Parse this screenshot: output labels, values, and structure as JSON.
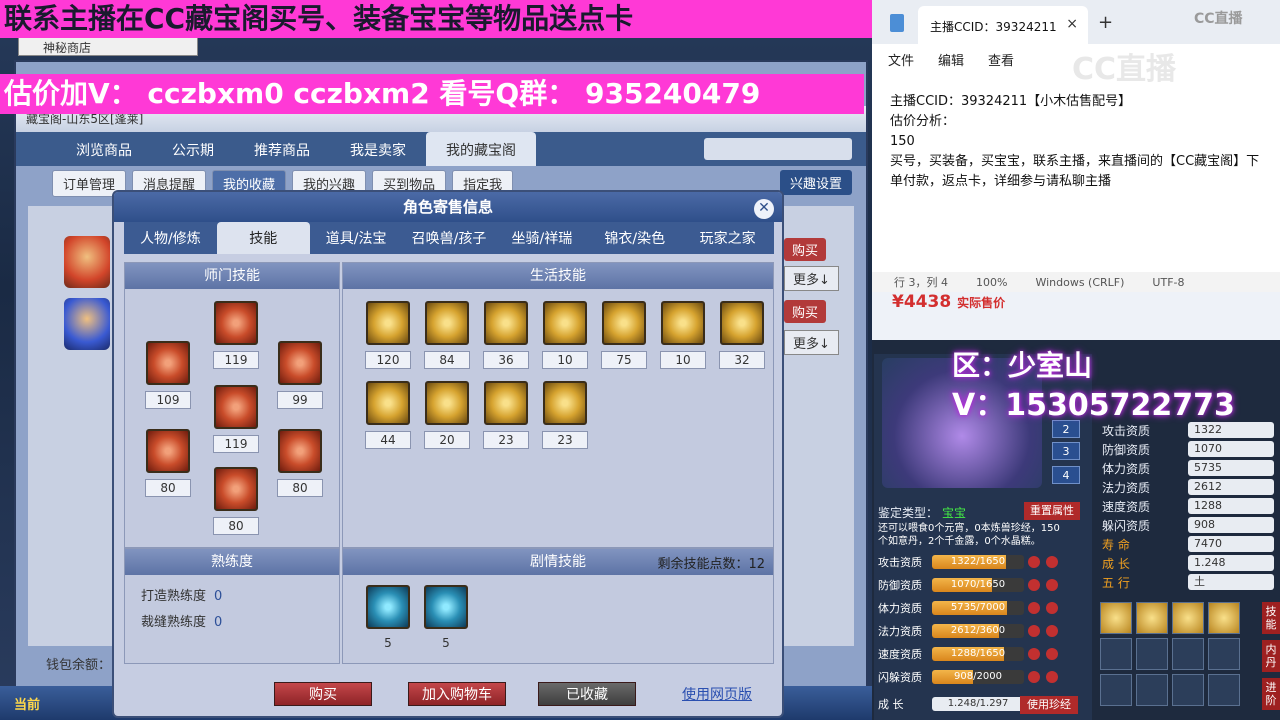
{
  "banners": {
    "top": "联系主播在CC藏宝阁买号、装备宝宝等物品送点卡",
    "middle": "估价加V： cczbxm0   cczbxm2   看号Q群： 935240479"
  },
  "game": {
    "small_tab": "神秘商店",
    "title_text": "藏宝阁-山东5区[蓬莱]",
    "tabs": [
      {
        "label": "浏览商品"
      },
      {
        "label": "公示期"
      },
      {
        "label": "推荐商品"
      },
      {
        "label": "我是卖家"
      },
      {
        "label": "我的藏宝阁"
      }
    ],
    "sub_tabs": [
      {
        "label": "订单管理"
      },
      {
        "label": "消息提醒"
      },
      {
        "label": "我的收藏"
      },
      {
        "label": "我的兴趣"
      },
      {
        "label": "买到物品"
      },
      {
        "label": "指定我"
      }
    ],
    "interest_setting": "兴趣设置",
    "buy_label": "购买",
    "more_label": "更多↓",
    "wallet_label": "钱包余额：",
    "taskbar_label": "当前"
  },
  "modal": {
    "title": "角色寄售信息",
    "close": "✕",
    "tabs": [
      {
        "label": "人物/修炼"
      },
      {
        "label": "技能"
      },
      {
        "label": "道具/法宝"
      },
      {
        "label": "召唤兽/孩子"
      },
      {
        "label": "坐骑/祥瑞"
      },
      {
        "label": "锦衣/染色"
      },
      {
        "label": "玩家之家"
      }
    ],
    "sect_title": "师门技能",
    "sect_skills": [
      {
        "level": "119",
        "icon": "red-skill-icon"
      },
      {
        "level": "109",
        "icon": "red-skill-icon"
      },
      {
        "level": "99",
        "icon": "red-skill-icon"
      },
      {
        "level": "119",
        "icon": "red-skill-icon"
      },
      {
        "level": "80",
        "icon": "red-skill-icon"
      },
      {
        "level": "80",
        "icon": "red-skill-icon"
      },
      {
        "level": "80",
        "icon": "red-skill-icon"
      }
    ],
    "life_title": "生活技能",
    "life_skills": [
      {
        "level": "120"
      },
      {
        "level": "84"
      },
      {
        "level": "36"
      },
      {
        "level": "10"
      },
      {
        "level": "75"
      },
      {
        "level": "10"
      },
      {
        "level": "32"
      },
      {
        "level": "44"
      },
      {
        "level": "20"
      },
      {
        "level": "23"
      },
      {
        "level": "23"
      }
    ],
    "prof_title": "熟练度",
    "forging_label": "打造熟练度",
    "forging_value": "0",
    "tailoring_label": "裁缝熟练度",
    "tailoring_value": "0",
    "story_title": "剧情技能",
    "remaining_label": "剩余技能点数：",
    "remaining_value": "12",
    "story_skills": [
      {
        "level": "5"
      },
      {
        "level": "5"
      }
    ],
    "buttons": {
      "buy": "购买",
      "add_cart": "加入购物车",
      "favorited": "已收藏",
      "web": "使用网页版"
    }
  },
  "notepad": {
    "tab_title": "主播CCID：39324211",
    "tab_close": "×",
    "new_tab": "+",
    "logo_small": "CC直播",
    "logo_big": "CC直播",
    "menu": [
      {
        "label": "文件"
      },
      {
        "label": "编辑"
      },
      {
        "label": "查看"
      }
    ],
    "lines": [
      "主播CCID：39324211【小木估售配号】",
      "估价分析：",
      "150",
      "买号，买装备，买宝宝，联系主播，来直播间的【CC藏宝阁】下单付款，返点卡，详细参与请私聊主播"
    ],
    "status": {
      "pos": "行 3，列 4",
      "zoom": "100%",
      "eol": "Windows (CRLF)",
      "enc": "UTF-8"
    },
    "price": "¥4438",
    "price_note": "实际售价"
  },
  "pet": {
    "overlay_zone": "区：少室山",
    "overlay_v": "V：15305722773",
    "buttons": [
      "2",
      "3",
      "4"
    ],
    "type_label": "鉴定类型：",
    "type_value": "宝宝",
    "reset_label": "重置属性",
    "note": "还可以喂食0个元宵，0本炼兽珍经，150个如意丹，2个千金露，0个水晶糕。",
    "bars": [
      {
        "label": "攻击资质",
        "text": "1322/1650",
        "fill": 0.8
      },
      {
        "label": "防御资质",
        "text": "1070/1650",
        "fill": 0.65
      },
      {
        "label": "体力资质",
        "text": "5735/7000",
        "fill": 0.82
      },
      {
        "label": "法力资质",
        "text": "2612/3600",
        "fill": 0.73
      },
      {
        "label": "速度资质",
        "text": "1288/1650",
        "fill": 0.78
      },
      {
        "label": "闪躲资质",
        "text": "908/2000",
        "fill": 0.45
      }
    ],
    "growth_label": "成    长",
    "growth_text": "1.248/1.297",
    "zhenpin_label": "使用珍经",
    "attrs": [
      {
        "label": "攻击资质",
        "value": "1322"
      },
      {
        "label": "防御资质",
        "value": "1070"
      },
      {
        "label": "体力资质",
        "value": "5735"
      },
      {
        "label": "法力资质",
        "value": "2612"
      },
      {
        "label": "速度资质",
        "value": "1288"
      },
      {
        "label": "躲闪资质",
        "value": "908"
      },
      {
        "label": "寿    命",
        "value": "7470"
      },
      {
        "label": "成    长",
        "value": "1.248"
      },
      {
        "label": "五    行",
        "value": "土"
      }
    ],
    "side_tabs": [
      "技能",
      "内丹",
      "进阶"
    ]
  },
  "colors": {
    "banner": "#ff39d6",
    "price": "#d32f2f"
  }
}
